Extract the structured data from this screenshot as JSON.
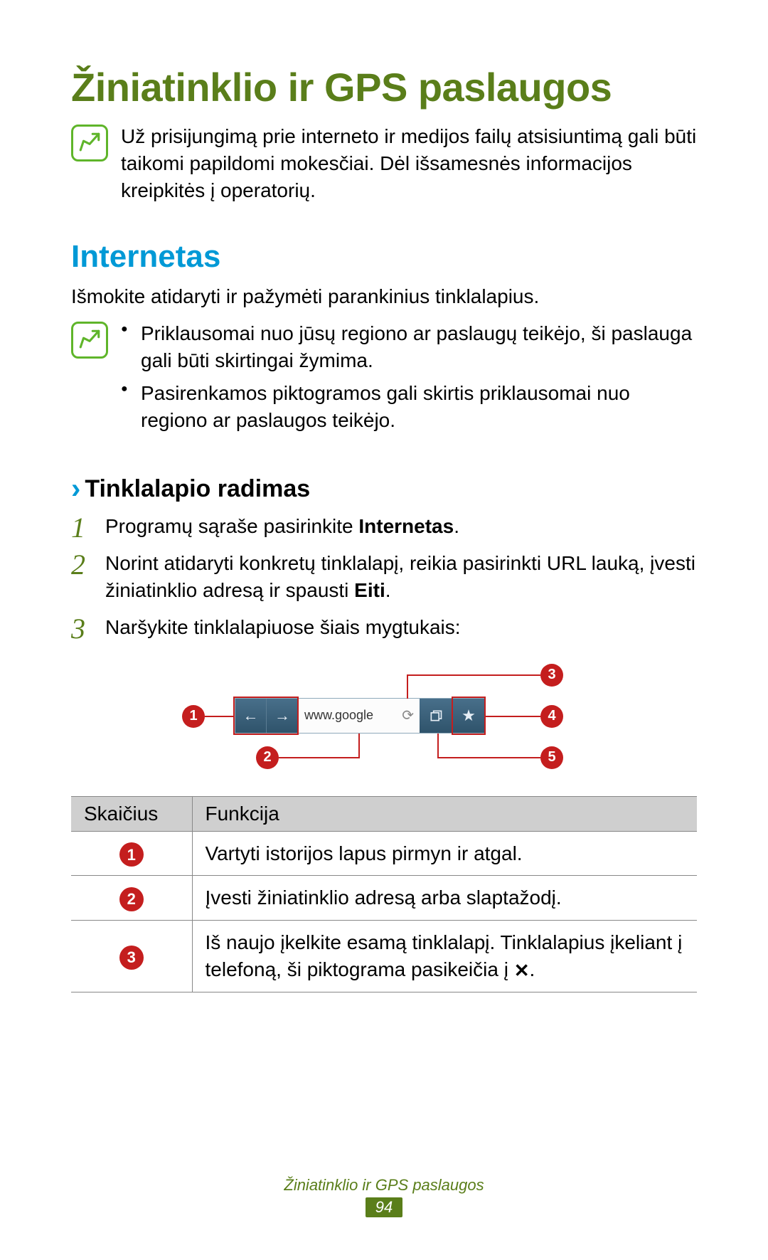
{
  "title": "Žiniatinklio ir GPS paslaugos",
  "top_note": "Už prisijungimą prie interneto ir medijos failų atsisiuntimą gali būti taikomi papildomi mokesčiai. Dėl išsamesnės informacijos kreipkitės į operatorių.",
  "section": {
    "heading": "Internetas",
    "intro": "Išmokite atidaryti ir pažymėti parankinius tinklalapius.",
    "bullets": [
      "Priklausomai nuo jūsų regiono ar paslaugų teikėjo, ši paslauga gali būti skirtingai žymima.",
      "Pasirenkamos piktogramos gali skirtis priklausomai nuo regiono ar paslaugos teikėjo."
    ]
  },
  "subsection": {
    "heading": "Tinklalapio radimas",
    "steps": [
      {
        "num": "1",
        "text_before": "Programų sąraše pasirinkite ",
        "bold": "Internetas",
        "text_after": "."
      },
      {
        "num": "2",
        "text_before": "Norint atidaryti konkretų tinklalapį, reikia pasirinkti URL lauką, įvesti žiniatinklio adresą ir spausti ",
        "bold": "Eiti",
        "text_after": "."
      },
      {
        "num": "3",
        "text_before": "Naršykite tinklalapiuose šiais mygtukais:",
        "bold": "",
        "text_after": ""
      }
    ]
  },
  "figure": {
    "url_text": "www.google",
    "callouts": [
      "1",
      "2",
      "3",
      "4",
      "5"
    ]
  },
  "table": {
    "headers": [
      "Skaičius",
      "Funkcija"
    ],
    "rows": [
      {
        "num": "1",
        "func": "Vartyti istorijos lapus pirmyn ir atgal."
      },
      {
        "num": "2",
        "func": "Įvesti žiniatinklio adresą arba slaptažodį."
      },
      {
        "num": "3",
        "func": "Iš naujo įkelkite esamą tinklalapį. Tinklalapius įkeliant į telefoną, ši piktograma pasikeičia į ",
        "has_x": true,
        "func_after": "."
      }
    ]
  },
  "footer": {
    "section": "Žiniatinklio ir GPS paslaugos",
    "page": "94"
  }
}
